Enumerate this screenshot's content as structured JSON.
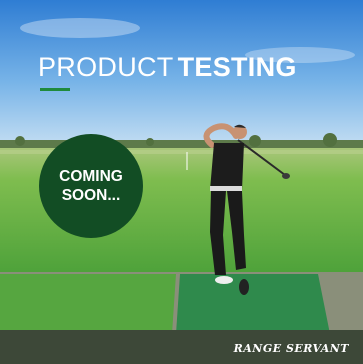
{
  "headline": {
    "light": "PRODUCT",
    "bold": "TESTING"
  },
  "badge": {
    "text": "COMING\nSOON..."
  },
  "brand": {
    "logo_text": "RANGE SERVANT"
  },
  "colors": {
    "accent_green": "#1f8a3c",
    "badge_green": "#124d24",
    "sky_top": "#2f7dd3",
    "grass": "#5fb33f",
    "mat_dark": "#2f8a4c",
    "mat_light": "#56a640",
    "footer": "#3d4838"
  },
  "icons": {
    "person": "golfer-figure",
    "club": "golf-club"
  }
}
